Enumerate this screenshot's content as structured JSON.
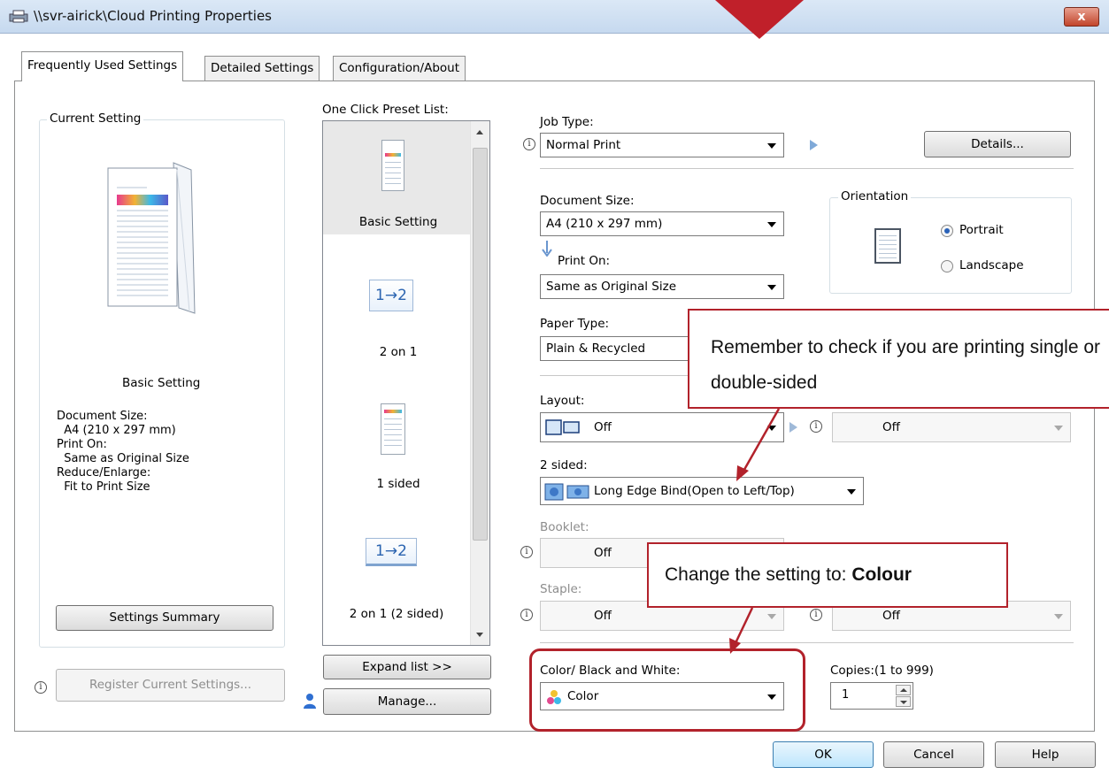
{
  "window": {
    "title": "\\\\svr-airick\\Cloud Printing Properties",
    "close_label": "x"
  },
  "tabs": [
    {
      "label": "Frequently Used Settings"
    },
    {
      "label": "Detailed Settings"
    },
    {
      "label": "Configuration/About"
    }
  ],
  "current_setting": {
    "legend": "Current Setting",
    "name": "Basic Setting",
    "summary_lines": [
      "Document Size:",
      "  A4 (210 x 297 mm)",
      "Print On:",
      "  Same as Original Size",
      "Reduce/Enlarge:",
      "  Fit to Print Size"
    ],
    "settings_summary_button": "Settings Summary",
    "register_button": "Register Current Settings..."
  },
  "preset_list": {
    "label": "One Click Preset List:",
    "items": [
      {
        "label": "Basic Setting",
        "icon": "document-color-icon"
      },
      {
        "label": "2 on 1",
        "icon": "n-up-icon",
        "badge": "1→2"
      },
      {
        "label": "1 sided",
        "icon": "document-color-icon"
      },
      {
        "label": "2 on 1 (2 sided)",
        "icon": "n-up-duplex-icon",
        "badge": "1→2"
      }
    ],
    "expand_button": "Expand list >>",
    "manage_button": "Manage..."
  },
  "job_type": {
    "label": "Job Type:",
    "value": "Normal Print",
    "details_button": "Details..."
  },
  "document_size": {
    "label": "Document Size:",
    "value": "A4 (210 x 297 mm)"
  },
  "print_on": {
    "label": "Print On:",
    "value": "Same as Original Size"
  },
  "orientation": {
    "legend": "Orientation",
    "portrait": "Portrait",
    "landscape": "Landscape",
    "selected": "Portrait"
  },
  "paper_type": {
    "label": "Paper Type:",
    "value": "Plain & Recycled"
  },
  "layout": {
    "label": "Layout:",
    "value": "Off",
    "second_value": "Off"
  },
  "two_sided": {
    "label": "2 sided:",
    "value": "Long Edge Bind(Open to Left/Top)"
  },
  "booklet": {
    "label": "Booklet:",
    "value": "Off"
  },
  "staple": {
    "label": "Staple:",
    "value": "Off",
    "second_value": "Off"
  },
  "color_bw": {
    "label": "Color/ Black and White:",
    "value": "Color"
  },
  "copies": {
    "label": "Copies:(1 to 999)",
    "value": "1"
  },
  "footer_buttons": {
    "ok": "OK",
    "cancel": "Cancel",
    "help": "Help"
  },
  "callouts": {
    "sided": "Remember to check if you are printing single or double-sided",
    "colour_prefix": "Change the setting to: ",
    "colour_bold": "Colour"
  },
  "colors": {
    "callout_border": "#b2222b",
    "accent_blue": "#2a62b8"
  }
}
